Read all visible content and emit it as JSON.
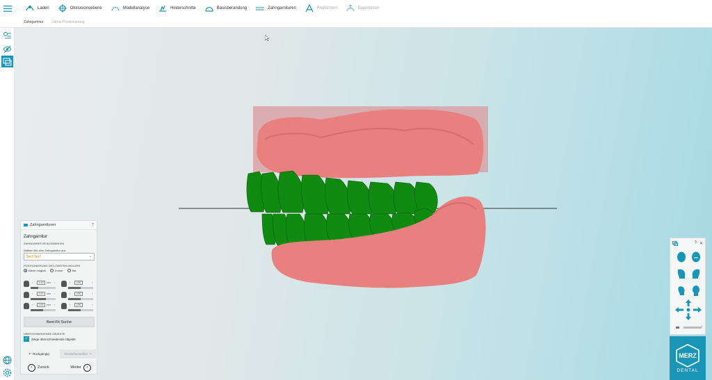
{
  "toolbar": {
    "items": [
      {
        "label": "Laden",
        "icon": "open-model-icon",
        "enabled": true
      },
      {
        "label": "Okklusionsebene",
        "icon": "occlusion-plane-icon",
        "enabled": true
      },
      {
        "label": "Modellanalyse",
        "icon": "model-analysis-icon",
        "enabled": true
      },
      {
        "label": "Hinterschnitte",
        "icon": "undercuts-icon",
        "enabled": true
      },
      {
        "label": "Basisberandung",
        "icon": "base-outline-icon",
        "enabled": true
      },
      {
        "label": "Zahngarnituren",
        "icon": "tooth-sets-icon",
        "enabled": true
      },
      {
        "label": "Freiformen",
        "icon": "freeform-icon",
        "enabled": false
      },
      {
        "label": "Exportieren",
        "icon": "export-icon",
        "enabled": false
      }
    ]
  },
  "subtabs": {
    "active": "Zahngarnitur",
    "inactive": "Zähne Positionierung"
  },
  "panel": {
    "header": "Zahngarnituren",
    "help": "?",
    "title": "Zahngarnitur",
    "section1": "ZAHNGARNITUR AUSWÄHLEN",
    "prompt": "Wählen Sie eine Zahngarnitur aus",
    "selected_set": "5m7-5m7",
    "section2": "POSITIONIERUNG DES ZWEITEN MOLARS",
    "radios": [
      {
        "label": "Wenn möglich",
        "checked": true
      },
      {
        "label": "Immer",
        "checked": false
      },
      {
        "label": "Nie",
        "checked": false
      }
    ],
    "controls": [
      {
        "value": "0.10",
        "unit": "mm",
        "level": 0.3
      },
      {
        "value": "0.00",
        "unit": "",
        "level": 0.5
      },
      {
        "value": "4.00",
        "unit": "mm",
        "level": 0.6
      },
      {
        "value": "0.00",
        "unit": "",
        "level": 0.5
      },
      {
        "value": "0.00",
        "unit": "mm",
        "level": 0.5
      },
      {
        "value": "0.00",
        "unit": "",
        "level": 0.5
      }
    ],
    "bestfit": "Best-Fit Suche",
    "section3": "ÜBERSCHNEIDENDE OBJEKTE",
    "checkbox_label": "Zeige überschneidende Objekte",
    "checkbox_checked": true,
    "undo": "Rückgängig",
    "redo": "Wiederherstellen",
    "back": "Zurück",
    "next": "Weiter"
  },
  "viewpanel": {
    "help": "?",
    "close": "✕"
  },
  "logo": {
    "brand": "MERZ",
    "sub": "DENTAL"
  },
  "colors": {
    "accent": "#1b95b5",
    "gum": "#e57f80",
    "teeth": "#0f8a0f",
    "select_text": "#e08a00"
  }
}
